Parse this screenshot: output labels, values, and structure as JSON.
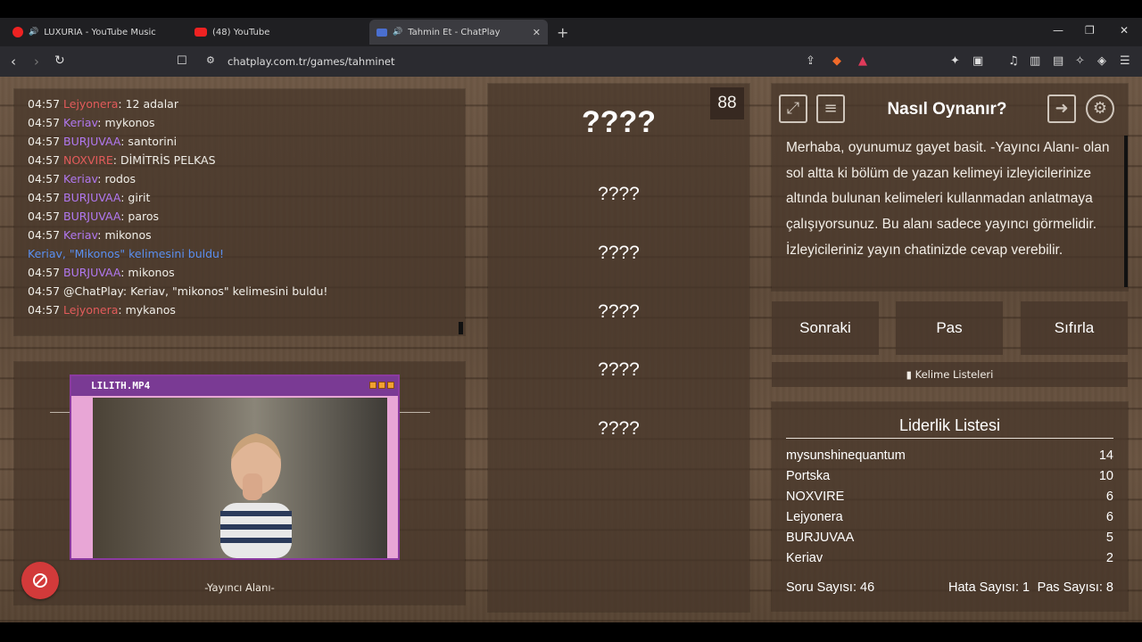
{
  "browser": {
    "tabs": [
      {
        "title": "LUXURIA - YouTube Music",
        "icon": "youtube-music-icon"
      },
      {
        "title": "(48) YouTube",
        "icon": "youtube-icon"
      },
      {
        "title": "Tahmin Et - ChatPlay",
        "icon": "chatplay-icon",
        "active": true
      }
    ],
    "url": "chatplay.com.tr/games/tahminet"
  },
  "chat": {
    "messages": [
      {
        "time": "04:57",
        "user": "Lejyonera",
        "user_color": "red",
        "text": ": 12 adalar"
      },
      {
        "time": "04:57",
        "user": "Keriav",
        "user_color": "purple",
        "text": ": mykonos"
      },
      {
        "time": "04:57",
        "user": "BURJUVAA",
        "user_color": "purple",
        "text": ": santorini"
      },
      {
        "time": "04:57",
        "user": "NOXVIRE",
        "user_color": "red",
        "text": ": DİMİTRİS PELKAS"
      },
      {
        "time": "04:57",
        "user": "Keriav",
        "user_color": "purple",
        "text": ": rodos"
      },
      {
        "time": "04:57",
        "user": "BURJUVAA",
        "user_color": "purple",
        "text": ": girit"
      },
      {
        "time": "04:57",
        "user": "BURJUVAA",
        "user_color": "purple",
        "text": ": paros"
      },
      {
        "time": "04:57",
        "user": "Keriav",
        "user_color": "purple",
        "text": ": mikonos"
      },
      {
        "time": "",
        "user": "",
        "user_color": "sys",
        "text": "Keriav, \"Mikonos\" kelimesini buldu!"
      },
      {
        "time": "04:57",
        "user": "BURJUVAA",
        "user_color": "purple",
        "text": ": mikonos"
      },
      {
        "time": "04:57",
        "user": "",
        "user_color": "",
        "text": "@ChatPlay: Keriav, \"mikonos\" kelimesini buldu!"
      },
      {
        "time": "04:57",
        "user": "Lejyonera",
        "user_color": "red",
        "text": ": mykanos"
      }
    ]
  },
  "stream": {
    "window_title": "LILITH.MP4",
    "label": "-Yayıncı Alanı-"
  },
  "words": {
    "main": "????",
    "items": [
      "????",
      "????",
      "????",
      "????",
      "????"
    ],
    "timer": "88"
  },
  "howto": {
    "title": "Nasıl Oynanır?",
    "text": "Merhaba, oyunumuz gayet basit. -Yayıncı Alanı- olan sol altta ki bölüm de yazan kelimeyi izleyicilerinize altında bulunan kelimeleri kullanmadan anlatmaya çalışıyorsunuz. Bu alanı sadece yayıncı görmelidir. İzleyicileriniz yayın chatinizde cevap verebilir."
  },
  "controls": {
    "next": "Sonraki",
    "pass": "Pas",
    "reset": "Sıfırla",
    "word_lists": "Kelime Listeleri"
  },
  "leaderboard": {
    "title": "Liderlik Listesi",
    "rows": [
      {
        "name": "mysunshinequantum",
        "score": "14"
      },
      {
        "name": "Portska",
        "score": "10"
      },
      {
        "name": "NOXVIRE",
        "score": "6"
      },
      {
        "name": "Lejyonera",
        "score": "6"
      },
      {
        "name": "BURJUVAA",
        "score": "5"
      },
      {
        "name": "Keriav",
        "score": "2"
      }
    ],
    "questions": "Soru Sayısı: 46",
    "errors": "Hata Sayısı: 1",
    "passes": "Pas Sayısı: 8"
  },
  "colors": {
    "user_red": "#e35b5b",
    "user_purple": "#b178f0",
    "system_blue": "#5a8ff0",
    "fab_red": "#d23a3a"
  }
}
